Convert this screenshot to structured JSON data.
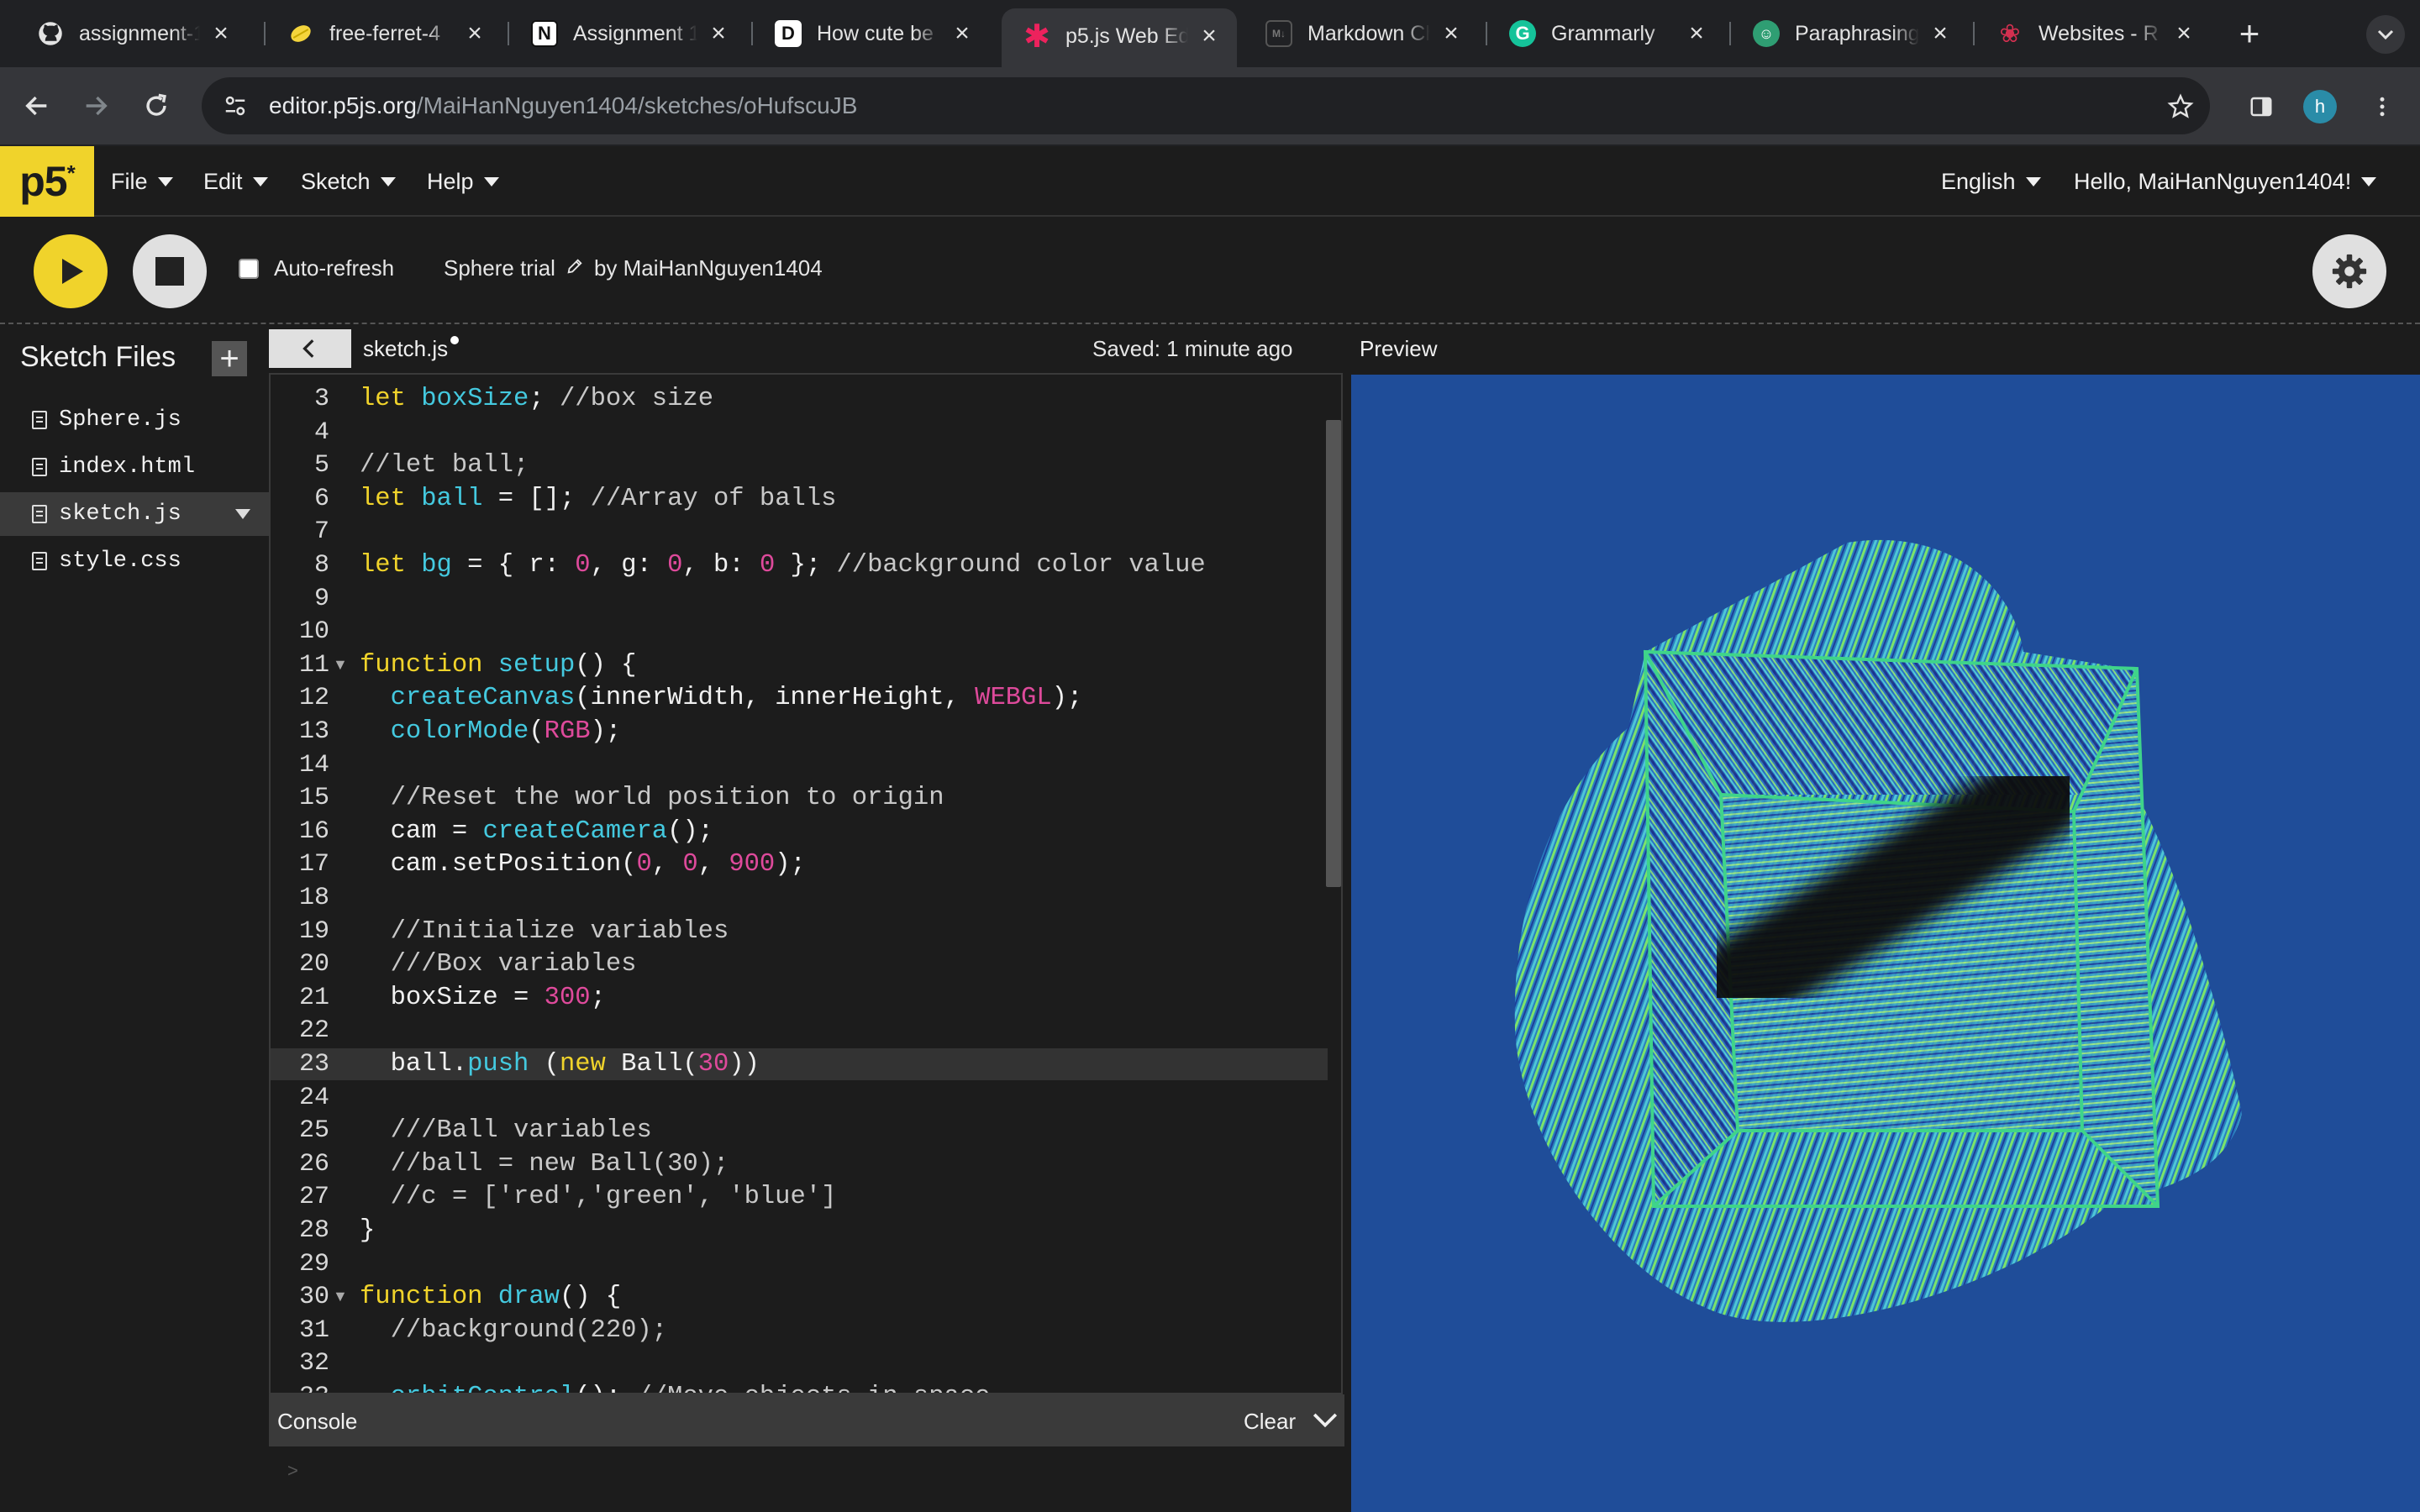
{
  "browser": {
    "tabs": [
      {
        "title": "assignment-1",
        "icon": "github-icon"
      },
      {
        "title": "free-ferret-4",
        "icon": "lemon-icon"
      },
      {
        "title": "Assignment 1",
        "icon": "notion-icon"
      },
      {
        "title": "How cute be",
        "icon": "d-icon"
      },
      {
        "title": "p5.js Web Ed",
        "icon": "p5-asterisk-icon"
      },
      {
        "title": "Markdown Ch",
        "icon": "markdown-icon"
      },
      {
        "title": "Grammarly",
        "icon": "grammarly-icon"
      },
      {
        "title": "Paraphrasing",
        "icon": "robot-icon"
      },
      {
        "title": "Websites - R",
        "icon": "rose-icon"
      }
    ],
    "url_host": "editor.p5js.org",
    "url_path": "/MaiHanNguyen1404/sketches/oHufscuJB",
    "profile_initial": "h"
  },
  "nav": {
    "logo": "p5",
    "menus": [
      "File",
      "Edit",
      "Sketch",
      "Help"
    ],
    "language": "English",
    "user": "Hello, MaiHanNguyen1404!"
  },
  "sketchbar": {
    "autorefresh_label": "Auto-refresh",
    "sketch_name": "Sphere trial",
    "owner": "by MaiHanNguyen1404"
  },
  "sidebar": {
    "title": "Sketch Files",
    "files": [
      "Sphere.js",
      "index.html",
      "sketch.js",
      "style.css"
    ],
    "selected": "sketch.js"
  },
  "editor": {
    "file_tab": "sketch.js",
    "saved": "Saved: 1 minute ago",
    "first_line": 3,
    "partial_top": "2",
    "partial_bottom": "34",
    "highlight_line": 23,
    "fold_lines": [
      11,
      30
    ],
    "lines": [
      "let boxSize; //box size",
      "",
      "//let ball;",
      "let ball = []; //Array of balls",
      "",
      "let bg = { r: 0, g: 0, b: 0 }; //background color value",
      "",
      "",
      "function setup() {",
      "  createCanvas(innerWidth, innerHeight, WEBGL);",
      "  colorMode(RGB);",
      "",
      "  //Reset the world position to origin",
      "  cam = createCamera();",
      "  cam.setPosition(0, 0, 900);",
      "",
      "  //Initialize variables",
      "  ///Box variables",
      "  boxSize = 300;",
      "",
      "  ball.push (new Ball(30))",
      "",
      "  ///Ball variables",
      "  //ball = new Ball(30);",
      "  //c = ['red','green', 'blue']",
      "}",
      "",
      "function draw() {",
      "  //background(220);",
      "",
      "  orbitControl(); //Move objects in space"
    ]
  },
  "console": {
    "title": "Console",
    "clear": "Clear",
    "prompt": ">"
  },
  "preview": {
    "label": "Preview",
    "background": "#1f4d99"
  },
  "colors": {
    "accent": "#f0d32b",
    "keyword": "#f0d32b",
    "identifier": "#44c9df",
    "number": "#de4a9b",
    "p5_pink": "#ed225d"
  }
}
